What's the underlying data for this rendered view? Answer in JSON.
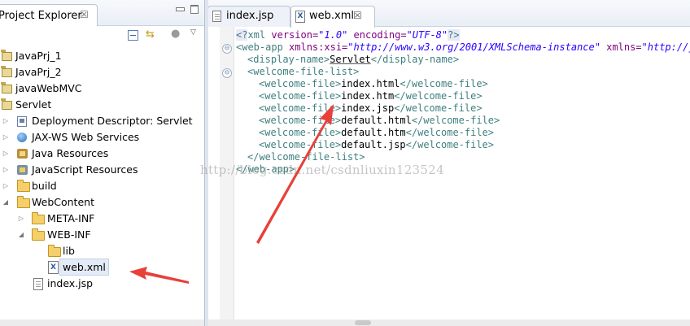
{
  "explorer": {
    "tab_label": "Project Explorer",
    "close_glyph": "☒",
    "toolbar": {
      "collapse_icon": "collapse-all-icon",
      "link_icon": "⇆",
      "filter_icon": "●",
      "menu_icon": "▽"
    },
    "tree": [
      {
        "label": "JavaPrj_1",
        "icon": "project-icon"
      },
      {
        "label": "JavaPrj_2",
        "icon": "project-icon"
      },
      {
        "label": "javaWebMVC",
        "icon": "project-icon"
      },
      {
        "label": "Servlet",
        "icon": "project-icon"
      },
      {
        "label": "Deployment Descriptor: Servlet",
        "icon": "deployment-descriptor-icon"
      },
      {
        "label": "JAX-WS Web Services",
        "icon": "web-services-icon"
      },
      {
        "label": "Java Resources",
        "icon": "java-resources-icon"
      },
      {
        "label": "JavaScript Resources",
        "icon": "javascript-resources-icon"
      },
      {
        "label": "build",
        "icon": "folder-icon"
      },
      {
        "label": "WebContent",
        "icon": "folder-icon"
      },
      {
        "label": "META-INF",
        "icon": "folder-icon"
      },
      {
        "label": "WEB-INF",
        "icon": "folder-icon"
      },
      {
        "label": "lib",
        "icon": "folder-icon"
      },
      {
        "label": "web.xml",
        "icon": "xml-file-icon",
        "selected": true
      },
      {
        "label": "index.jsp",
        "icon": "jsp-file-icon"
      }
    ],
    "twisty_collapsed": "▷",
    "twisty_expanded": "◢"
  },
  "editor": {
    "tabs": [
      {
        "label": "index.jsp",
        "active": false
      },
      {
        "label": "web.xml",
        "active": true,
        "close_glyph": "☒"
      }
    ],
    "xml_icon_glyph": "X",
    "fold_glyph": "⊖",
    "code": {
      "l1": {
        "open": "<?",
        "name": "xml",
        "a1": " version=",
        "v1": "\"1.0\"",
        "a2": " encoding=",
        "v2": "\"UTF-8\"",
        "close": "?>"
      },
      "l2": {
        "tag": "<web-app",
        "a1": " xmlns:xsi=",
        "v1": "\"http://www.w3.org/2001/XMLSchema-instance\"",
        "a2": " xmlns=",
        "v2": "\"http://java.sun.com/xml/ns/javaee\""
      },
      "l3": {
        "open": "<display-name>",
        "text": "Servlet",
        "close": "</display-name>"
      },
      "l4": {
        "tag": "<welcome-file-list>"
      },
      "welcome_files": [
        "index.html",
        "index.htm",
        "index.jsp",
        "default.html",
        "default.htm",
        "default.jsp"
      ],
      "wf_open": "<welcome-file>",
      "wf_close": "</welcome-file>",
      "l11": {
        "tag": "</welcome-file-list>"
      },
      "l12": {
        "tag": "</web-app>"
      }
    }
  },
  "watermark": "http://blog.csdn.net/csdnliuxin123524",
  "colors": {
    "tag": "#3f7f7f",
    "attr": "#7f007f",
    "value": "#2a00ff",
    "arrow": "#e8403a"
  }
}
